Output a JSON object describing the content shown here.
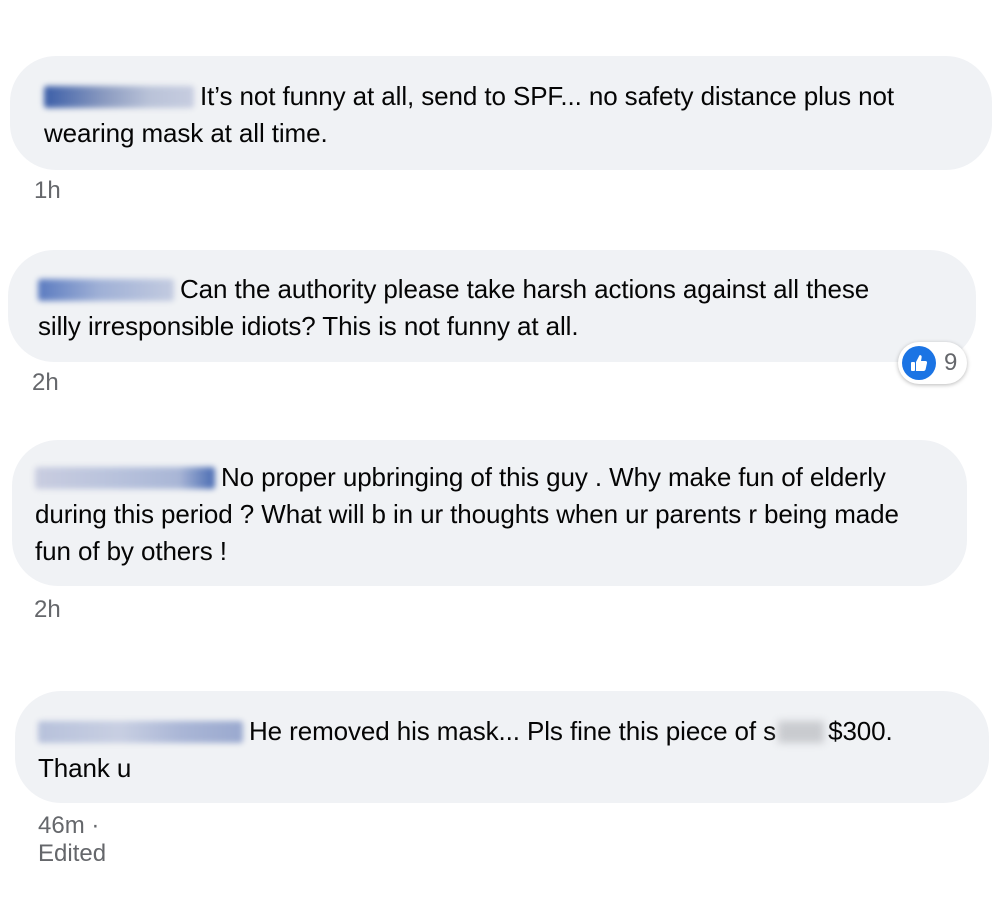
{
  "comments": [
    {
      "text": "It’s not funny at all, send to SPF... no safety distance plus not wearing mask at all time.",
      "time": "1h"
    },
    {
      "text": "Can the authority please take harsh actions against all these silly irresponsible idiots? This is not funny at all.",
      "time": "2h",
      "reaction_count": "9",
      "reaction_icon": "like-icon"
    },
    {
      "text": "No proper upbringing of this guy . Why make fun of elderly during this period ? What will b in ur thoughts when ur parents r being made fun of by others !",
      "time": "2h"
    },
    {
      "text_before": "He removed his mask... Pls fine this piece of s",
      "text_after": "$300. Thank u",
      "time": "46m",
      "edited_label": "Edited",
      "separator": "·"
    }
  ],
  "colors": {
    "bubble": "#f0f2f5",
    "meta_text": "#65676b",
    "like_blue": "#1b74e4"
  }
}
